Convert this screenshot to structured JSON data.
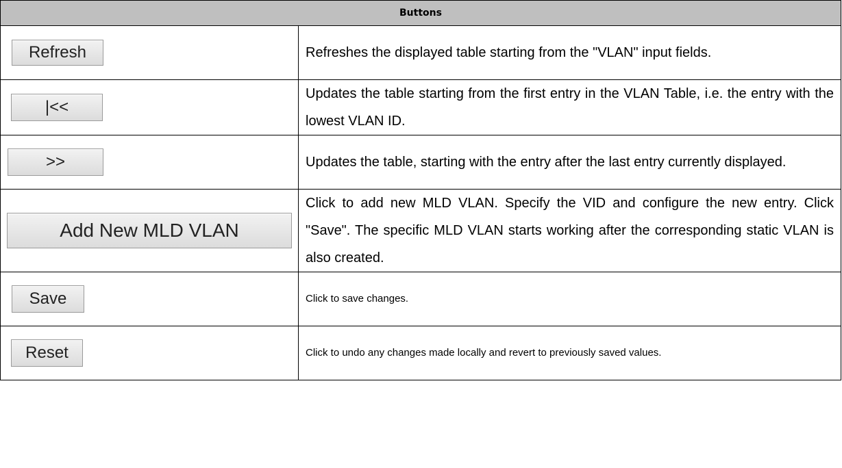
{
  "header": {
    "title": "Buttons"
  },
  "rows": [
    {
      "button_label": "Refresh",
      "description": "Refreshes the displayed table starting from the \"VLAN\" input fields."
    },
    {
      "button_label": "|<<",
      "description": "Updates the table starting from the first entry in the VLAN Table, i.e. the entry with the lowest VLAN ID."
    },
    {
      "button_label": ">>",
      "description": "Updates the table, starting with the entry after the last entry currently displayed."
    },
    {
      "button_label": "Add New MLD VLAN",
      "description": "Click to add new MLD VLAN. Specify the VID and configure the new entry. Click \"Save\". The specific MLD VLAN starts working after the corresponding static VLAN is also created."
    },
    {
      "button_label": "Save",
      "description": "Click to save changes."
    },
    {
      "button_label": "Reset",
      "description": "Click to undo any changes made locally and revert to previously saved values."
    }
  ]
}
